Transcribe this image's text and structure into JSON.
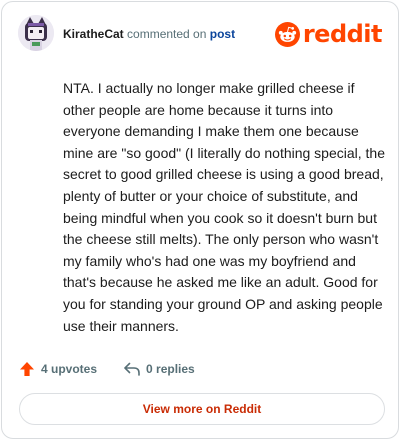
{
  "header": {
    "author": "KiratheCat",
    "action": "commented on",
    "post_link": "post",
    "logo_text": "reddit",
    "avatar_icon": "cat-avatar",
    "logo_icon": "reddit-snoo-icon"
  },
  "comment": {
    "body": "NTA. I actually no longer make grilled cheese if other people are home because it turns into everyone demanding I make them one because mine are \"so good\" (I literally do nothing special, the secret to good grilled cheese is using a good bread, plenty of butter or your choice of substitute, and being mindful when you cook so it doesn't burn but the cheese still melts). The only person who wasn't my family who's had one was my boyfriend and that's because he asked me like an adult. Good for you for standing your ground OP and asking people use their manners."
  },
  "footer": {
    "upvotes": "4 upvotes",
    "replies": "0 replies",
    "view_more": "View more on Reddit"
  },
  "colors": {
    "brand": "#ff4500",
    "upvote": "#ff4500",
    "link": "#0a449b",
    "button_text": "#c92b04",
    "muted": "#576f76"
  }
}
